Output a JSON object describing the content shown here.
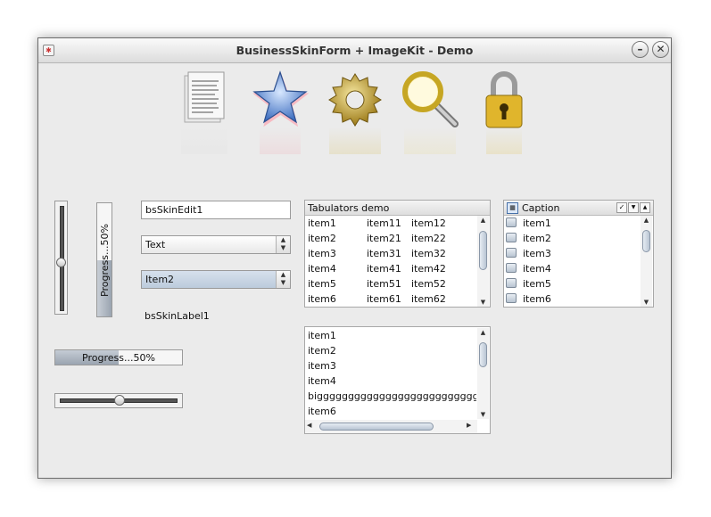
{
  "window": {
    "title": "BusinessSkinForm + ImageKit - Demo"
  },
  "toolbar_icons": [
    "document-icon",
    "star-icon",
    "gear-icon",
    "magnifier-icon",
    "padlock-icon"
  ],
  "controls": {
    "edit1": "bsSkinEdit1",
    "combo1": "Text",
    "combo2": "Item2",
    "label1": "bsSkinLabel1",
    "vprogress": {
      "text": "Progress...50%",
      "value": 0.5
    },
    "hprogress": {
      "text": "Progress...50%",
      "value": 0.5
    },
    "vtrackbar_value": 0.55,
    "htrackbar_value": 0.5
  },
  "tab_list": {
    "caption": "Tabulators demo",
    "rows": [
      [
        "item1",
        "item11",
        "item12"
      ],
      [
        "item2",
        "item21",
        "item22"
      ],
      [
        "item3",
        "item31",
        "item32"
      ],
      [
        "item4",
        "item41",
        "item42"
      ],
      [
        "item5",
        "item51",
        "item52"
      ],
      [
        "item6",
        "item61",
        "item62"
      ]
    ]
  },
  "check_list": {
    "caption": "Caption",
    "items": [
      "item1",
      "item2",
      "item3",
      "item4",
      "item5",
      "item6"
    ]
  },
  "plain_list": {
    "items": [
      "item1",
      "item2",
      "item3",
      "item4",
      "bigggggggggggggggggggggggggggggggg",
      "item6"
    ]
  },
  "colors": {
    "selection": "#c9d6e6",
    "progress_fill": "#a7b1bd"
  }
}
